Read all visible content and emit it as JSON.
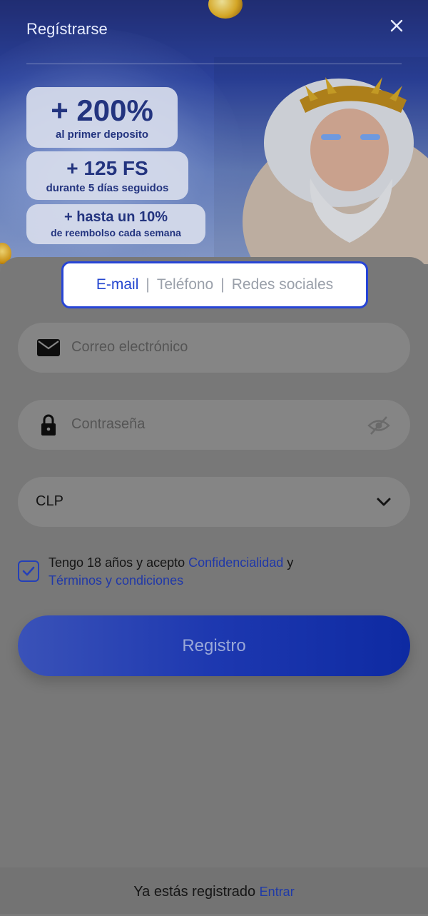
{
  "header": {
    "title": "Regístrarse"
  },
  "promos": [
    {
      "big": "+ 200%",
      "small": "al primer deposito"
    },
    {
      "big": "+ 125 FS",
      "small": "durante 5 días seguidos"
    },
    {
      "big": "+ hasta un 10%",
      "small": "de reembolso cada semana"
    }
  ],
  "tabs": {
    "email": "E-mail",
    "sep": "|",
    "phone": "Teléfono",
    "social": "Redes sociales",
    "active": "E-mail"
  },
  "form": {
    "email_placeholder": "Correo electrónico",
    "password_placeholder": "Contraseña",
    "currency_value": "CLP"
  },
  "terms": {
    "text_before": "Tengo 18 años y acepto ",
    "privacy_link": "Confidencialidad",
    "and": " y ",
    "terms_link": "Términos y condiciones",
    "checked": true
  },
  "register_label": "Registro",
  "footer": {
    "text": "Ya estás registrado ",
    "login_link": "Entrar"
  },
  "colors": {
    "accent": "#2446cf",
    "button": "#1d38b0",
    "overlay": "#7a7a7a"
  },
  "icons": {
    "close": "close-icon",
    "email": "envelope-icon",
    "password": "lock-icon",
    "visibility": "eye-off-icon",
    "dropdown": "chevron-down-icon",
    "checkbox": "checkmark-icon"
  }
}
